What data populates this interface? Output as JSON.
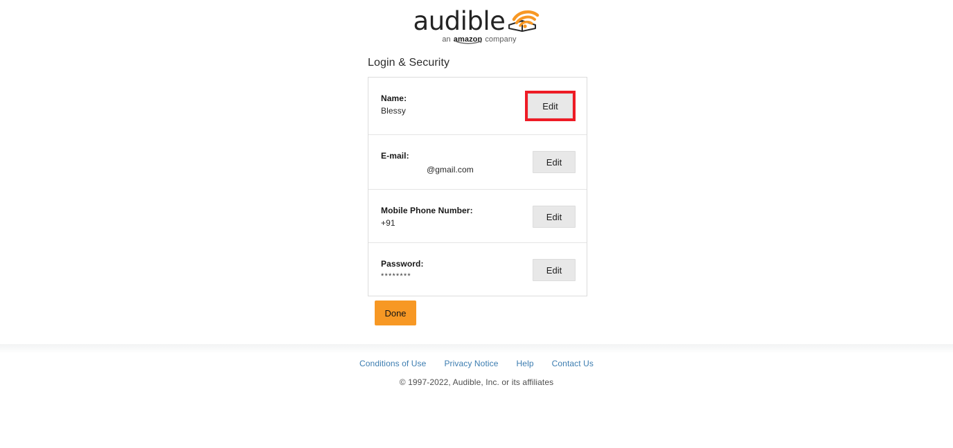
{
  "brand": {
    "wordmark": "audible",
    "tagline_prefix": "an",
    "tagline_amazon": "amazon",
    "tagline_suffix": "company",
    "logo_color": "#f79824",
    "wordmark_color": "#232323"
  },
  "page": {
    "heading": "Login & Security"
  },
  "account_rows": [
    {
      "label": "Name:",
      "value": "Blessy",
      "edit_label": "Edit",
      "highlighted": true
    },
    {
      "label": "E-mail:",
      "value": "@gmail.com",
      "edit_label": "Edit",
      "highlighted": false
    },
    {
      "label": "Mobile Phone Number:",
      "value": "+91",
      "edit_label": "Edit",
      "highlighted": false
    },
    {
      "label": "Password:",
      "value": "********",
      "edit_label": "Edit",
      "highlighted": false
    }
  ],
  "actions": {
    "done_label": "Done",
    "done_color": "#f79824"
  },
  "annotation": {
    "highlight_color": "#ee1b25"
  },
  "footer": {
    "links": [
      "Conditions of Use",
      "Privacy Notice",
      "Help",
      "Contact Us"
    ],
    "copyright": "© 1997-2022, Audible, Inc. or its affiliates",
    "link_color": "#3b7cb0"
  }
}
